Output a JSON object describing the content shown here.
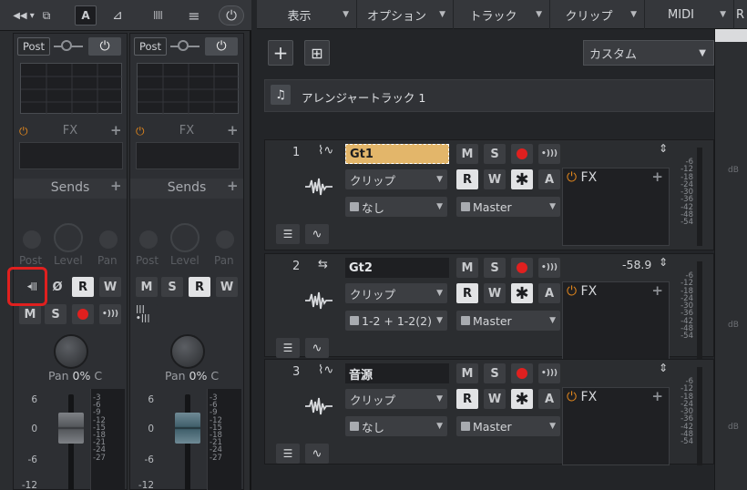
{
  "console_toolbar": {
    "arrows": "◀◀ ▾",
    "grid_icon": "⧉",
    "a_label": "A",
    "metro_icon": "⊿",
    "wave_icon": "|||||",
    "menu_icon": "≡",
    "power_icon": "⏻"
  },
  "strips": [
    {
      "post": "Post",
      "fx": "FX",
      "sends": "Sends",
      "knobs": [
        "Post",
        "Level",
        "Pan"
      ],
      "pan_label": "Pan",
      "pan_value": "0%",
      "pan_suffix": "C",
      "buttons": {
        "phase": "Ø",
        "read": "R",
        "write": "W",
        "mute": "M",
        "solo": "S"
      },
      "scale": [
        "6",
        "0",
        "-6",
        "-12"
      ],
      "meter_scale": [
        "-3",
        "-6",
        "-9",
        "-12",
        "-15",
        "-18",
        "-21",
        "-24",
        "-27"
      ]
    },
    {
      "post": "Post",
      "fx": "FX",
      "sends": "Sends",
      "knobs": [
        "Post",
        "Level",
        "Pan"
      ],
      "pan_label": "Pan",
      "pan_value": "0%",
      "pan_suffix": "C",
      "buttons": {
        "mute": "M",
        "solo": "S",
        "read": "R",
        "write": "W"
      },
      "scale": [
        "6",
        "0",
        "-6",
        "-12"
      ],
      "meter_scale": [
        "-3",
        "-6",
        "-9",
        "-12",
        "-15",
        "-18",
        "-21",
        "-24",
        "-27"
      ]
    }
  ],
  "menu": [
    {
      "label": "表示"
    },
    {
      "label": "オプション"
    },
    {
      "label": "トラック"
    },
    {
      "label": "クリップ"
    },
    {
      "label": "MIDI"
    },
    {
      "label": "R"
    }
  ],
  "arranger": {
    "add": "+",
    "preset": "カスタム",
    "arranger_track": "アレンジャートラック 1"
  },
  "tracks": [
    {
      "num": "1",
      "name": "Gt1",
      "clip": "クリップ",
      "input": "なし",
      "output": "Master",
      "fx": "FX",
      "volume": "",
      "selected": true,
      "meter_scale": [
        "-6",
        "-12",
        "-18",
        "-24",
        "-30",
        "-36",
        "-42",
        "-48",
        "-54"
      ]
    },
    {
      "num": "2",
      "name": "Gt2",
      "clip": "クリップ",
      "input": "1-2 + 1-2(2)",
      "output": "Master",
      "fx": "FX",
      "volume": "-58.9",
      "selected": false,
      "meter_scale": [
        "-6",
        "-12",
        "-18",
        "-24",
        "-30",
        "-36",
        "-42",
        "-48",
        "-54"
      ]
    },
    {
      "num": "3",
      "name": "音源",
      "clip": "クリップ",
      "input": "なし",
      "output": "Master",
      "fx": "FX",
      "volume": "",
      "selected": false,
      "meter_scale": [
        "-6",
        "-12",
        "-18",
        "-24",
        "-30",
        "-36",
        "-42",
        "-48",
        "-54"
      ]
    }
  ],
  "track_buttons": {
    "mute": "M",
    "solo": "S",
    "read": "R",
    "write": "W",
    "a": "A"
  },
  "side_db": "dB",
  "colors": {
    "accent": "#e3b66a",
    "record": "#e0201f",
    "power": "#e1861d",
    "highlight": "#e0201f"
  }
}
